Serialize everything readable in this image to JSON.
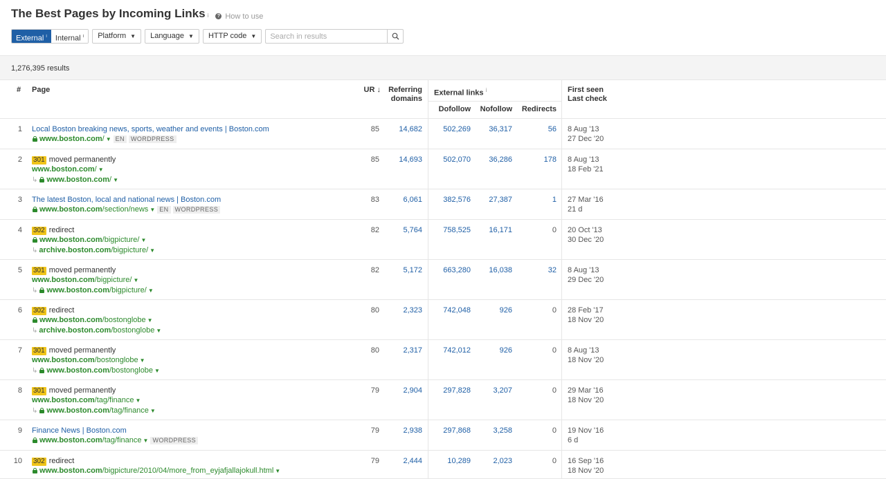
{
  "header": {
    "title": "The Best Pages by Incoming Links",
    "title_info": "i",
    "how_to": "How to use"
  },
  "filters": {
    "external": "External",
    "internal": "Internal",
    "info": "i",
    "platform": "Platform",
    "language": "Language",
    "http_code": "HTTP code",
    "search_placeholder": "Search in results"
  },
  "results": {
    "count": "1,276,395 results"
  },
  "columns": {
    "num": "#",
    "page": "Page",
    "ur": "UR",
    "ur_sort": "↓",
    "referring_1": "Referring",
    "referring_2": "domains",
    "external_links": "External links",
    "external_info": "i",
    "dofollow": "Dofollow",
    "nofollow": "Nofollow",
    "redirects": "Redirects",
    "first_seen": "First seen",
    "last_check": "Last check"
  },
  "rows": [
    {
      "num": "1",
      "title": "Local Boston breaking news, sports, weather and events | Boston.com",
      "url_host": "www.boston.com",
      "url_path": "/",
      "url_secure": true,
      "tags": [
        "EN",
        "WORDPRESS"
      ],
      "ur": "85",
      "rd": "14,682",
      "dofollow": "502,269",
      "nofollow": "36,317",
      "redirects": "56",
      "first_seen": "8 Aug '13",
      "last_check": "27 Dec '20"
    },
    {
      "num": "2",
      "code": "301",
      "status": "moved permanently",
      "url_host": "www.boston.com",
      "url_path": "/",
      "url_secure": false,
      "redir_host": "www.boston.com",
      "redir_path": "/",
      "redir_secure": true,
      "ur": "85",
      "rd": "14,693",
      "dofollow": "502,070",
      "nofollow": "36,286",
      "redirects": "178",
      "first_seen": "8 Aug '13",
      "last_check": "18 Feb '21"
    },
    {
      "num": "3",
      "title": "The latest Boston, local and national news | Boston.com",
      "url_host": "www.boston.com",
      "url_path": "/section/news",
      "url_secure": true,
      "tags": [
        "EN",
        "WORDPRESS"
      ],
      "ur": "83",
      "rd": "6,061",
      "dofollow": "382,576",
      "nofollow": "27,387",
      "redirects": "1",
      "first_seen": "27 Mar '16",
      "last_check": "21 d"
    },
    {
      "num": "4",
      "code": "302",
      "status": "redirect",
      "url_host": "www.boston.com",
      "url_path": "/bigpicture/",
      "url_secure": true,
      "redir_host": "archive.boston.com",
      "redir_path": "/bigpicture/",
      "redir_secure": false,
      "ur": "82",
      "rd": "5,764",
      "dofollow": "758,525",
      "nofollow": "16,171",
      "redirects": "0",
      "first_seen": "20 Oct '13",
      "last_check": "30 Dec '20"
    },
    {
      "num": "5",
      "code": "301",
      "status": "moved permanently",
      "url_host": "www.boston.com",
      "url_path": "/bigpicture/",
      "url_secure": false,
      "redir_host": "www.boston.com",
      "redir_path": "/bigpicture/",
      "redir_secure": true,
      "ur": "82",
      "rd": "5,172",
      "dofollow": "663,280",
      "nofollow": "16,038",
      "redirects": "32",
      "first_seen": "8 Aug '13",
      "last_check": "29 Dec '20"
    },
    {
      "num": "6",
      "code": "302",
      "status": "redirect",
      "url_host": "www.boston.com",
      "url_path": "/bostonglobe",
      "url_secure": true,
      "redir_host": "archive.boston.com",
      "redir_path": "/bostonglobe",
      "redir_secure": false,
      "ur": "80",
      "rd": "2,323",
      "dofollow": "742,048",
      "nofollow": "926",
      "redirects": "0",
      "first_seen": "28 Feb '17",
      "last_check": "18 Nov '20"
    },
    {
      "num": "7",
      "code": "301",
      "status": "moved permanently",
      "url_host": "www.boston.com",
      "url_path": "/bostonglobe",
      "url_secure": false,
      "redir_host": "www.boston.com",
      "redir_path": "/bostonglobe",
      "redir_secure": true,
      "ur": "80",
      "rd": "2,317",
      "dofollow": "742,012",
      "nofollow": "926",
      "redirects": "0",
      "first_seen": "8 Aug '13",
      "last_check": "18 Nov '20"
    },
    {
      "num": "8",
      "code": "301",
      "status": "moved permanently",
      "url_host": "www.boston.com",
      "url_path": "/tag/finance",
      "url_secure": false,
      "redir_host": "www.boston.com",
      "redir_path": "/tag/finance",
      "redir_secure": true,
      "ur": "79",
      "rd": "2,904",
      "dofollow": "297,828",
      "nofollow": "3,207",
      "redirects": "0",
      "first_seen": "29 Mar '16",
      "last_check": "18 Nov '20"
    },
    {
      "num": "9",
      "title": "Finance News | Boston.com",
      "url_host": "www.boston.com",
      "url_path": "/tag/finance",
      "url_secure": true,
      "tags": [
        "WORDPRESS"
      ],
      "ur": "79",
      "rd": "2,938",
      "dofollow": "297,868",
      "nofollow": "3,258",
      "redirects": "0",
      "first_seen": "19 Nov '16",
      "last_check": "6 d"
    },
    {
      "num": "10",
      "code": "302",
      "status": "redirect",
      "url_host": "www.boston.com",
      "url_path": "/bigpicture/2010/04/more_from_eyjafjallajokull.html",
      "url_secure": true,
      "ur": "79",
      "rd": "2,444",
      "dofollow": "10,289",
      "nofollow": "2,023",
      "redirects": "0",
      "first_seen": "16 Sep '16",
      "last_check": "18 Nov '20"
    }
  ]
}
